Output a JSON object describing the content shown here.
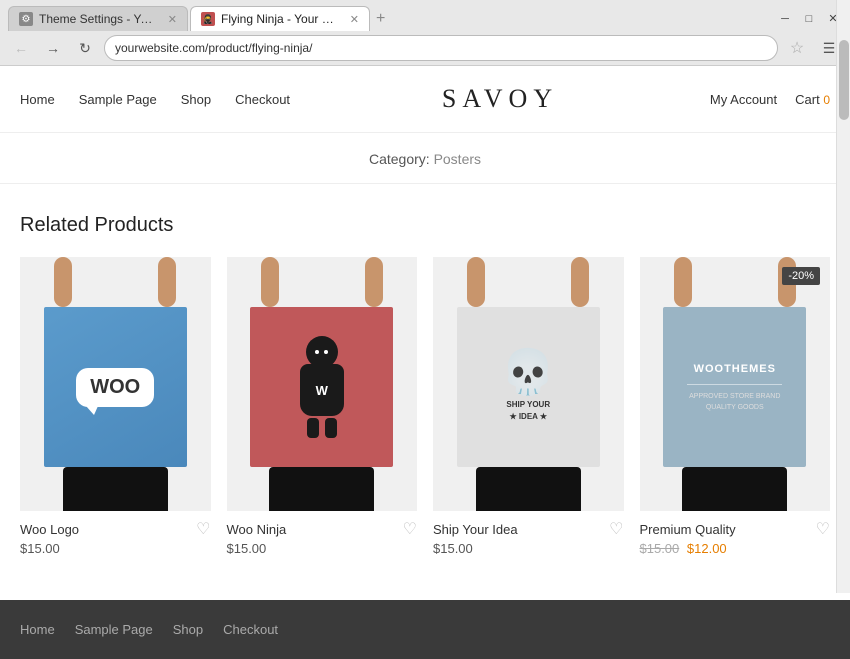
{
  "browser": {
    "tabs": [
      {
        "id": "tab1",
        "label": "Theme Settings - Your W...",
        "active": false,
        "icon": "🐧"
      },
      {
        "id": "tab2",
        "label": "Flying Ninja - Your Webs...",
        "active": true,
        "icon": "🥷"
      }
    ],
    "new_tab_label": "+",
    "address": "yourwebsite.com/product/flying-ninja/",
    "window_controls": [
      "─",
      "□",
      "✕"
    ]
  },
  "nav": {
    "links": [
      "Home",
      "Sample Page",
      "Shop",
      "Checkout"
    ],
    "logo": "SAVOY",
    "right_links": [
      "My Account",
      "Cart"
    ],
    "cart_count": "0"
  },
  "category": {
    "label": "Category:",
    "value": "Posters"
  },
  "related_products": {
    "section_title": "Related Products",
    "products": [
      {
        "name": "Woo Logo",
        "price": "$15.00",
        "sale_price": null,
        "old_price": null,
        "badge": null,
        "type": "woo"
      },
      {
        "name": "Woo Ninja",
        "price": "$15.00",
        "sale_price": null,
        "old_price": null,
        "badge": null,
        "type": "ninja"
      },
      {
        "name": "Ship Your Idea",
        "price": "$15.00",
        "sale_price": null,
        "old_price": null,
        "badge": null,
        "type": "skull"
      },
      {
        "name": "Premium Quality",
        "price": "$12.00",
        "sale_price": "$12.00",
        "old_price": "$15.00",
        "badge": "-20%",
        "type": "premium"
      }
    ]
  },
  "footer": {
    "links": [
      "Home",
      "Sample Page",
      "Shop",
      "Checkout"
    ]
  }
}
